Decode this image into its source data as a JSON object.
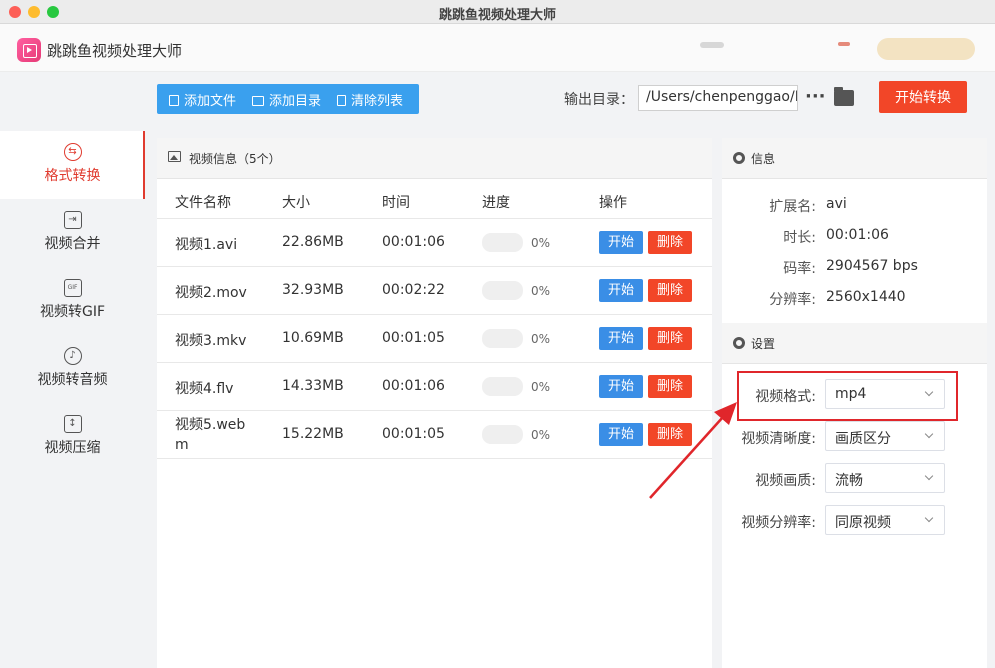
{
  "window": {
    "title": "跳跳鱼视频处理大师"
  },
  "app": {
    "name": "跳跳鱼视频处理大师"
  },
  "sidebar": {
    "items": [
      {
        "label": "格式转换",
        "icon": "format-convert-icon",
        "active": true
      },
      {
        "label": "视频合并",
        "icon": "merge-icon",
        "active": false
      },
      {
        "label": "视频转GIF",
        "icon": "gif-icon",
        "active": false
      },
      {
        "label": "视频转音频",
        "icon": "audio-icon",
        "active": false
      },
      {
        "label": "视频压缩",
        "icon": "compress-icon",
        "active": false
      }
    ]
  },
  "toolbar": {
    "add_file": "添加文件",
    "add_folder": "添加目录",
    "clear_list": "清除列表",
    "output_label": "输出目录：",
    "output_path": "/Users/chenpenggao/D",
    "more": "···",
    "start_convert": "开始转换"
  },
  "video_list": {
    "title": "视频信息（5个）",
    "columns": [
      "文件名称",
      "大小",
      "时间",
      "进度",
      "操作"
    ],
    "rows": [
      {
        "name": "视频1.avi",
        "size": "22.86MB",
        "time": "00:01:06",
        "progress": "0%",
        "start": "开始",
        "delete": "删除"
      },
      {
        "name": "视频2.mov",
        "size": "32.93MB",
        "time": "00:02:22",
        "progress": "0%",
        "start": "开始",
        "delete": "删除"
      },
      {
        "name": "视频3.mkv",
        "size": "10.69MB",
        "time": "00:01:05",
        "progress": "0%",
        "start": "开始",
        "delete": "删除"
      },
      {
        "name": "视频4.flv",
        "size": "14.33MB",
        "time": "00:01:06",
        "progress": "0%",
        "start": "开始",
        "delete": "删除"
      },
      {
        "name": "视频5.web\nm",
        "size": "15.22MB",
        "time": "00:01:05",
        "progress": "0%",
        "start": "开始",
        "delete": "删除"
      }
    ]
  },
  "info": {
    "title": "信息",
    "ext_label": "扩展名:",
    "ext": "avi",
    "duration_label": "时长:",
    "duration": "00:01:06",
    "bitrate_label": "码率:",
    "bitrate": "2904567 bps",
    "resolution_label": "分辨率:",
    "resolution": "2560x1440"
  },
  "settings": {
    "title": "设置",
    "format_label": "视频格式:",
    "format": "mp4",
    "clarity_label": "视频清晰度:",
    "clarity": "画质区分",
    "quality_label": "视频画质:",
    "quality": "流畅",
    "resolution_label": "视频分辨率:",
    "resolution": "同原视频"
  },
  "colors": {
    "accent_red": "#f24628",
    "accent_blue": "#3a8ee6",
    "toolbar_blue": "#3aa0ee",
    "annotation_red": "#e0262b"
  }
}
